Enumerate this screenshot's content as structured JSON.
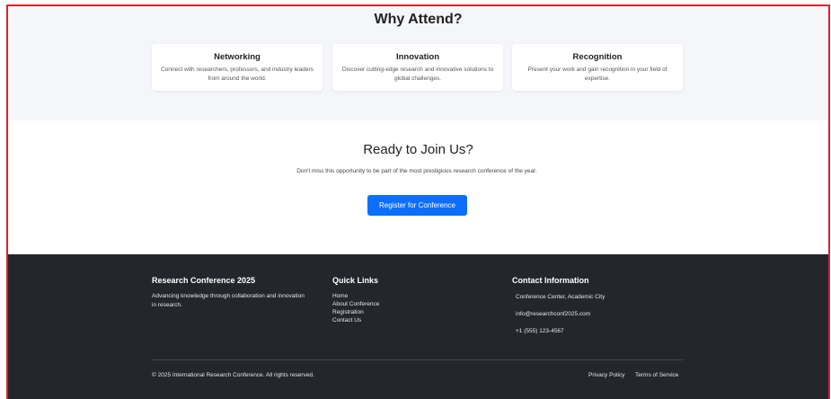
{
  "why": {
    "title": "Why Attend?",
    "cards": [
      {
        "title": "Networking",
        "desc": "Connect with researchers, professors, and industry leaders from around the world."
      },
      {
        "title": "Innovation",
        "desc": "Discover cutting-edge research and innovative solutions to global challenges."
      },
      {
        "title": "Recognition",
        "desc": "Present your work and gain recognition in your field of expertise."
      }
    ]
  },
  "join": {
    "title": "Ready to Join Us?",
    "text": "Don't miss this opportunity to be part of the most prestigious research conference of the year.",
    "button": "Register for Conference"
  },
  "footer": {
    "brand_title": "Research Conference 2025",
    "brand_text": "Advancing knowledge through collaboration and innovation in research.",
    "links_title": "Quick Links",
    "links": [
      "Home",
      "About Conference",
      "Registration",
      "Contact Us"
    ],
    "contact_title": "Contact Information",
    "contact": [
      "Conference Center, Academic City",
      "info@researchconf2025.com",
      "+1 (555) 123-4567"
    ],
    "copyright": "© 2025 International Research Conference. All rights reserved.",
    "privacy": "Privacy Policy",
    "terms": "Terms of Service"
  },
  "colors": {
    "accent": "#0d6efd",
    "footer_bg": "#23272c",
    "section_bg": "#f4f6f9",
    "frame_border": "#d9242b"
  }
}
